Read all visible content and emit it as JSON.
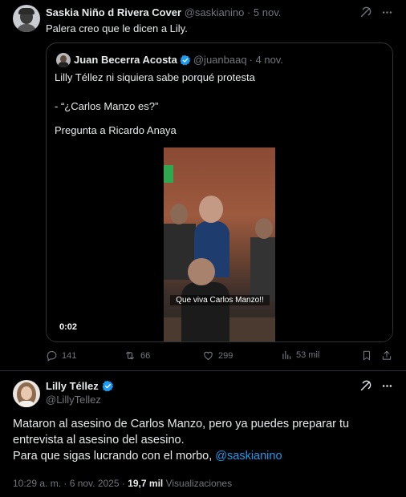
{
  "tweet1": {
    "author_name": "Saskia Niño d Rivera Cover",
    "author_handle": "@saskianino",
    "date": "· 5 nov.",
    "text": "Palera creo que le dicen a Lily.",
    "quote": {
      "author_name": "Juan Becerra Acosta",
      "author_handle": "@juanbaaq",
      "date": "· 4 nov.",
      "line1": "Lilly Téllez ni siquiera sabe porqué protesta",
      "line2": "- “¿Carlos Manzo es?”",
      "line3": "Pregunta a Ricardo Anaya",
      "video_caption": "Que viva Carlos Manzo!!",
      "video_duration": "0:02"
    },
    "actions": {
      "replies": "141",
      "reposts": "66",
      "likes": "299",
      "views": "53 mil"
    }
  },
  "tweet2": {
    "author_name": "Lilly Téllez",
    "author_handle": "@LillyTellez",
    "text_line1": "Mataron al asesino de Carlos Manzo, pero ya puedes preparar tu",
    "text_line2": "entrevista al asesino del asesino.",
    "text_line3": "Para que sigas lucrando con el morbo,",
    "mention": "@saskianino",
    "time": "10:29 a. m. · 6 nov. 2025 ·",
    "views_count": "19,7 mil",
    "views_label": "Visualizaciones"
  },
  "colors": {
    "background": "#000000",
    "text": "#e7e9ea",
    "muted": "#71767b",
    "accent": "#1d9bf0",
    "border": "#2f3336"
  }
}
